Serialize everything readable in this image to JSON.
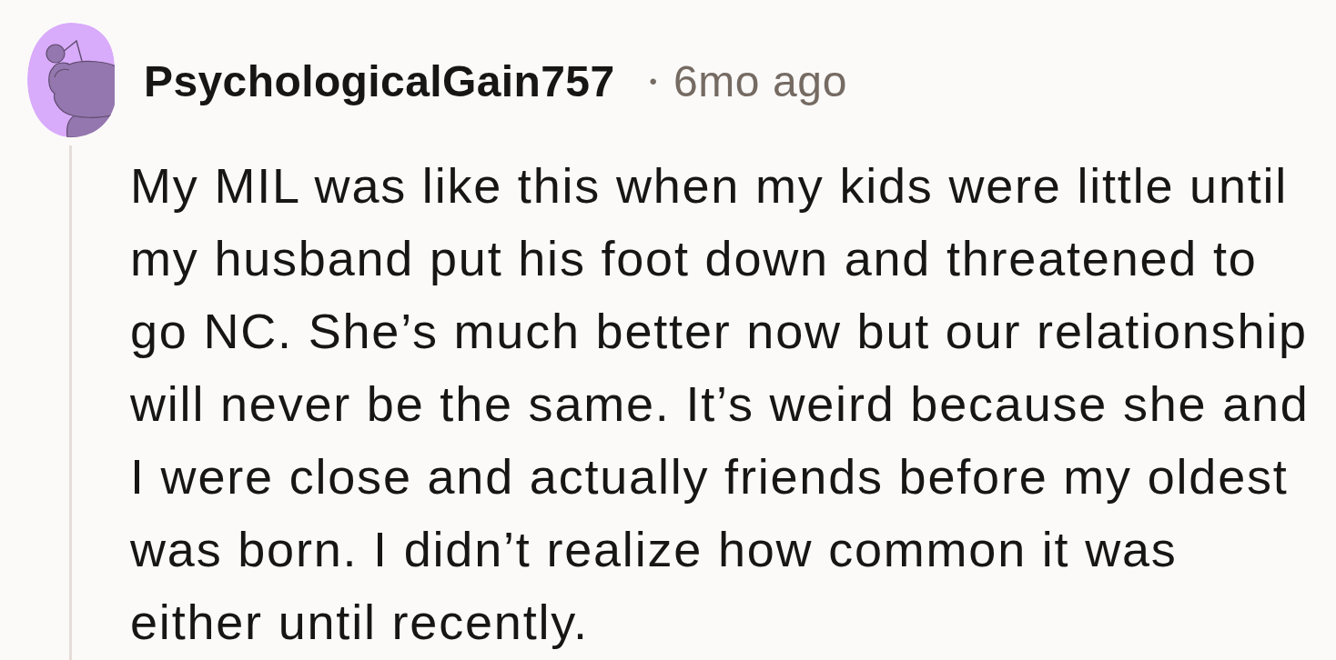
{
  "comment": {
    "author": "PsychologicalGain757",
    "separator": "•",
    "time": "6mo ago",
    "body": "My MIL was like this when my kids were little until my husband put his foot down and threatened to go NC. She’s much better now but our relationship will never be the same. It’s weird because she and I were close and actually friends before my oldest was born. I didn’t realize how common it was either until recently."
  }
}
